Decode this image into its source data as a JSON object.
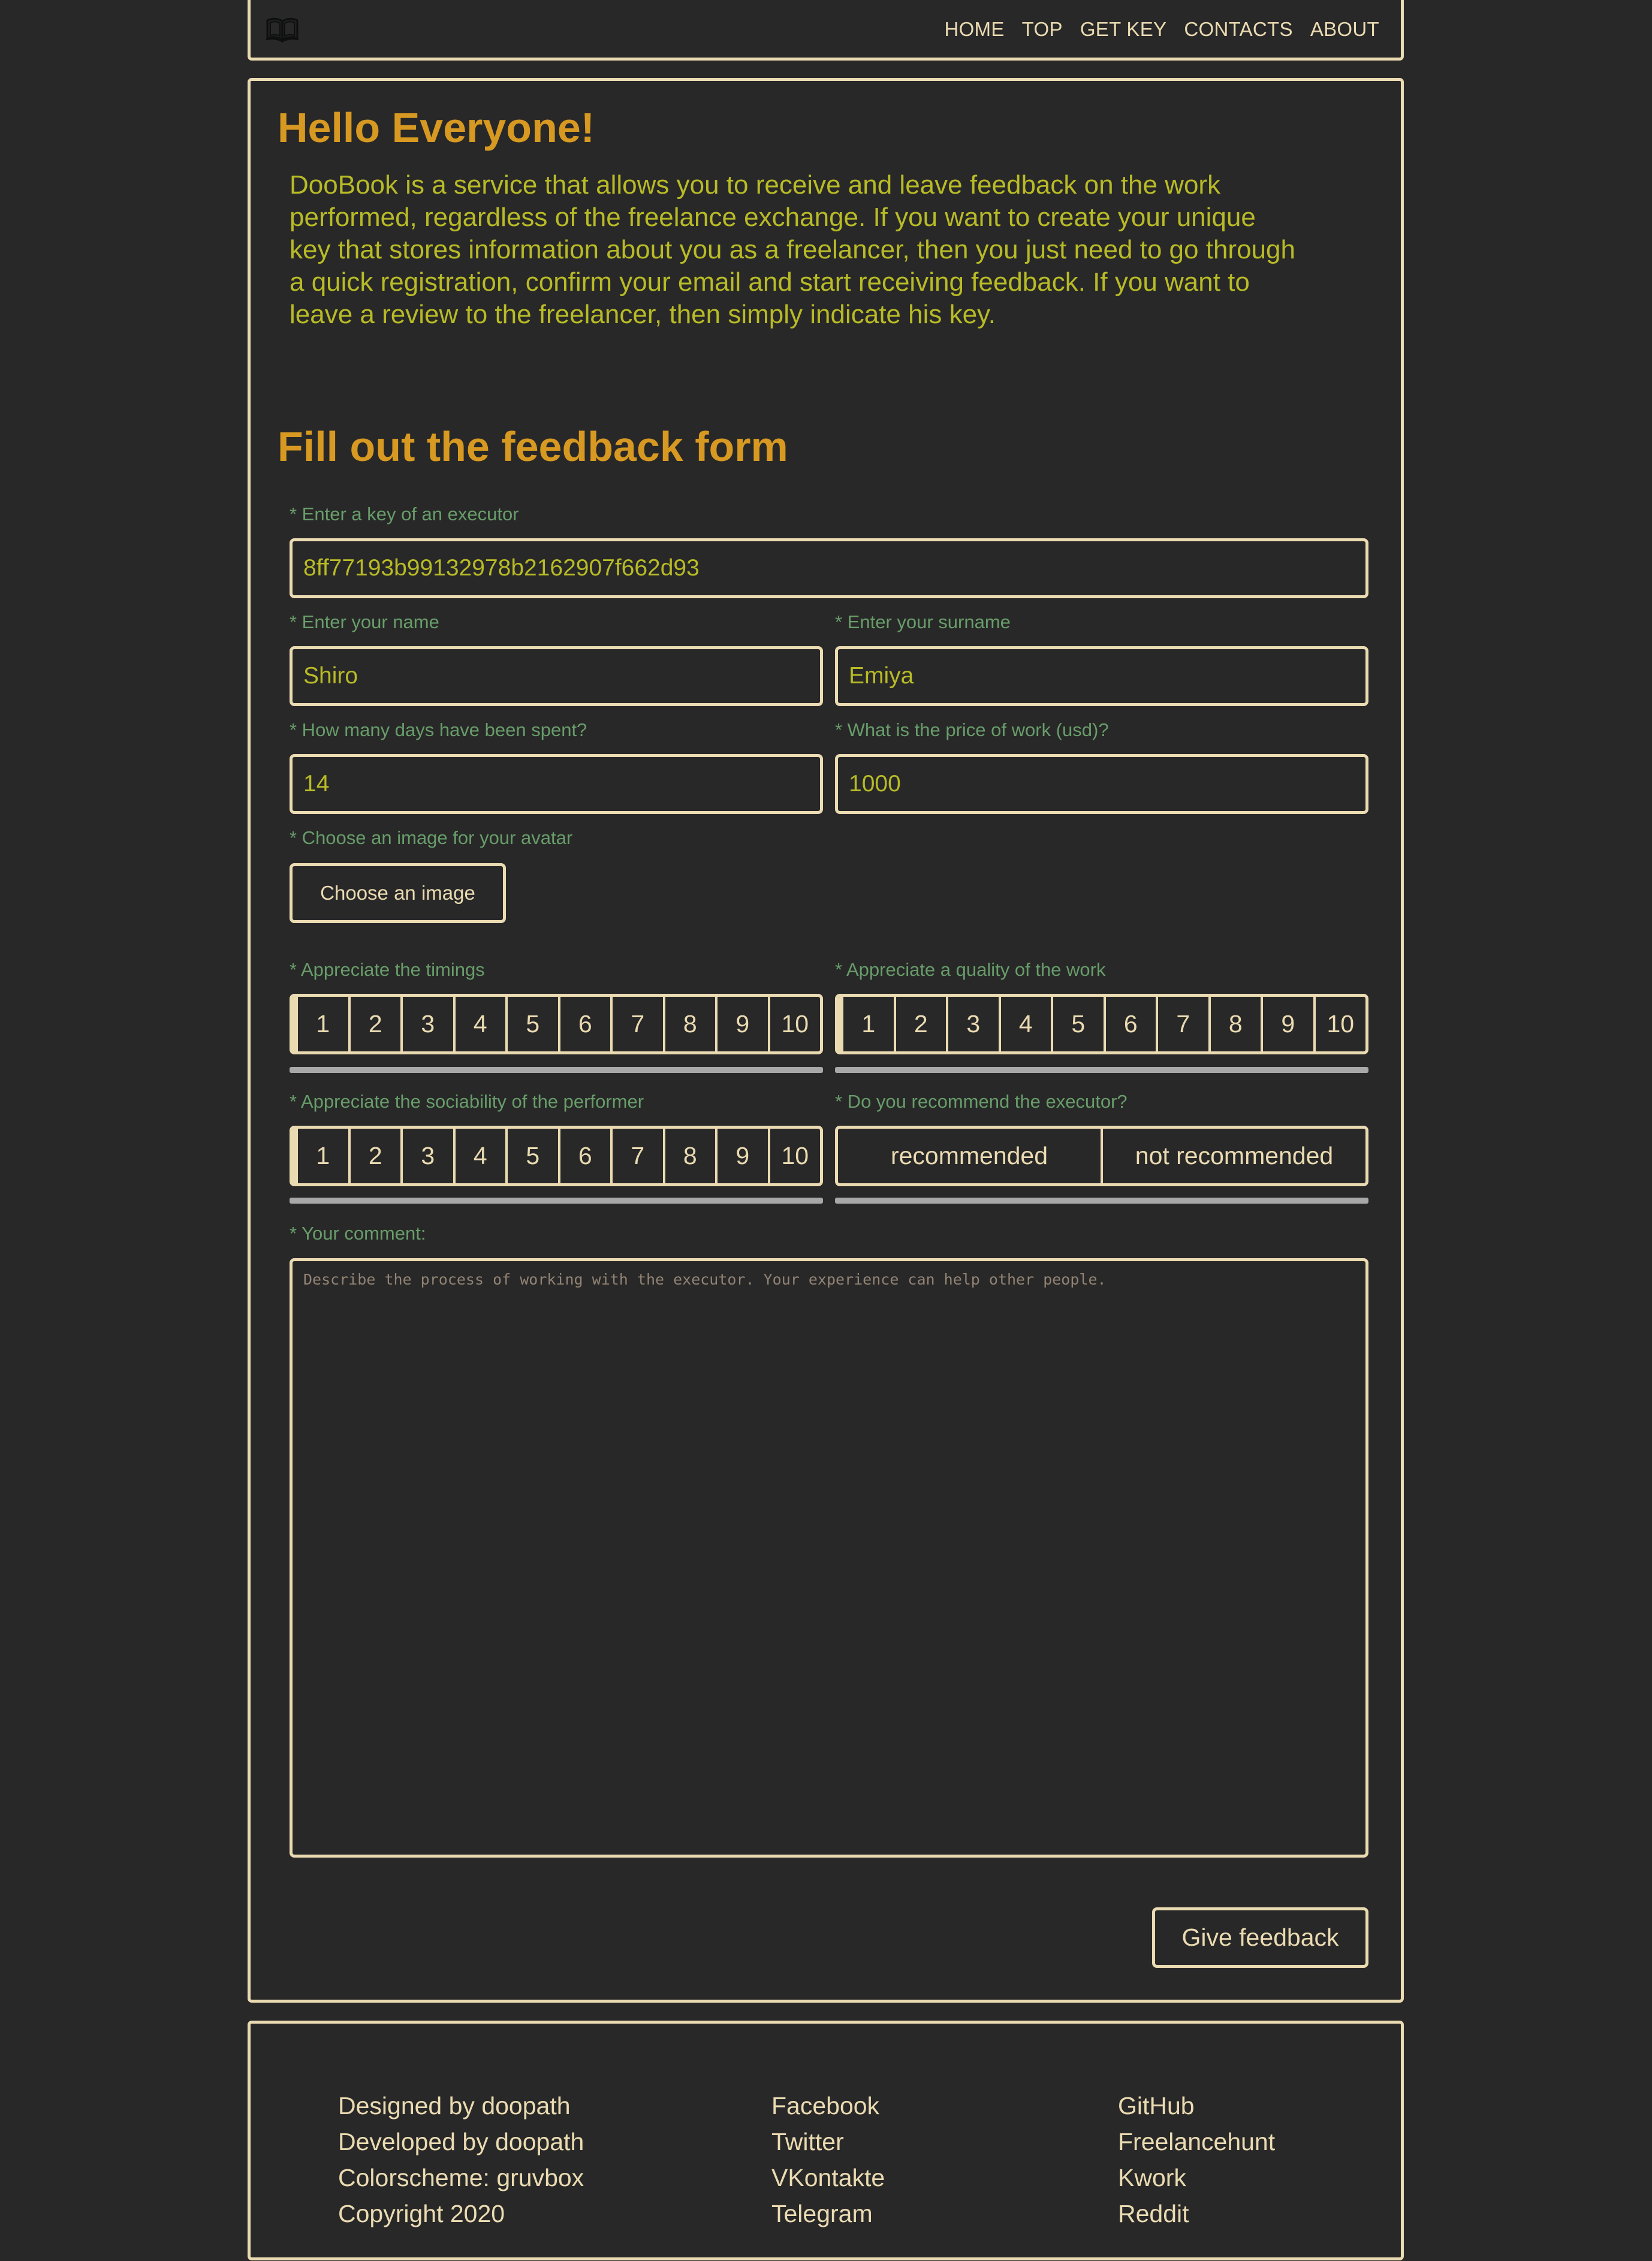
{
  "header": {
    "logo_icon": "open-book-icon",
    "nav": [
      "HOME",
      "TOP",
      "GET KEY",
      "CONTACTS",
      "ABOUT"
    ]
  },
  "intro": {
    "title": "Hello Everyone!",
    "text": "DooBook is a service that allows you to receive and leave feedback on the work performed, regardless of the freelance exchange. If you want to create your unique key that stores information about you as a freelancer, then you just need to go through a quick registration, confirm your email and start receiving feedback. If you want to leave a review to the freelancer, then simply indicate his key."
  },
  "form": {
    "title": "Fill out the feedback form",
    "key": {
      "label": "* Enter a key of an executor",
      "value": "8ff77193b99132978b2162907f662d93"
    },
    "name": {
      "label": "* Enter your name",
      "value": "Shiro"
    },
    "surname": {
      "label": "* Enter your surname",
      "value": "Emiya"
    },
    "days": {
      "label": "* How many days have been spent?",
      "value": "14"
    },
    "price": {
      "label": "* What is the price of work (usd)?",
      "value": "1000"
    },
    "avatar": {
      "label": "* Choose an image for your avatar",
      "button": "Choose an image"
    },
    "timings": {
      "label": "* Appreciate the timings",
      "options": [
        "1",
        "2",
        "3",
        "4",
        "5",
        "6",
        "7",
        "8",
        "9",
        "10"
      ]
    },
    "quality": {
      "label": "* Appreciate a quality of the work",
      "options": [
        "1",
        "2",
        "3",
        "4",
        "5",
        "6",
        "7",
        "8",
        "9",
        "10"
      ]
    },
    "sociability": {
      "label": "* Appreciate the sociability of the performer",
      "options": [
        "1",
        "2",
        "3",
        "4",
        "5",
        "6",
        "7",
        "8",
        "9",
        "10"
      ]
    },
    "recommend": {
      "label": "* Do you recommend the executor?",
      "options": [
        "recommended",
        "not recommended"
      ]
    },
    "comment": {
      "label": "* Your comment:",
      "placeholder": "Describe the process of working with the executor. Your experience can help other people."
    },
    "submit": "Give feedback"
  },
  "footer": {
    "credits": [
      "Designed by doopath",
      "Developed by doopath",
      "Colorscheme: gruvbox",
      "Copyright 2020"
    ],
    "social": [
      "Facebook",
      "Twitter",
      "VKontakte",
      "Telegram"
    ],
    "platforms": [
      "GitHub",
      "Freelancehunt",
      "Kwork",
      "Reddit"
    ]
  },
  "colors": {
    "background": "#282828",
    "border": "#ebdbb2",
    "heading": "#d79921",
    "text": "#b8bb26",
    "label": "#689d6a",
    "placeholder": "#928374"
  }
}
